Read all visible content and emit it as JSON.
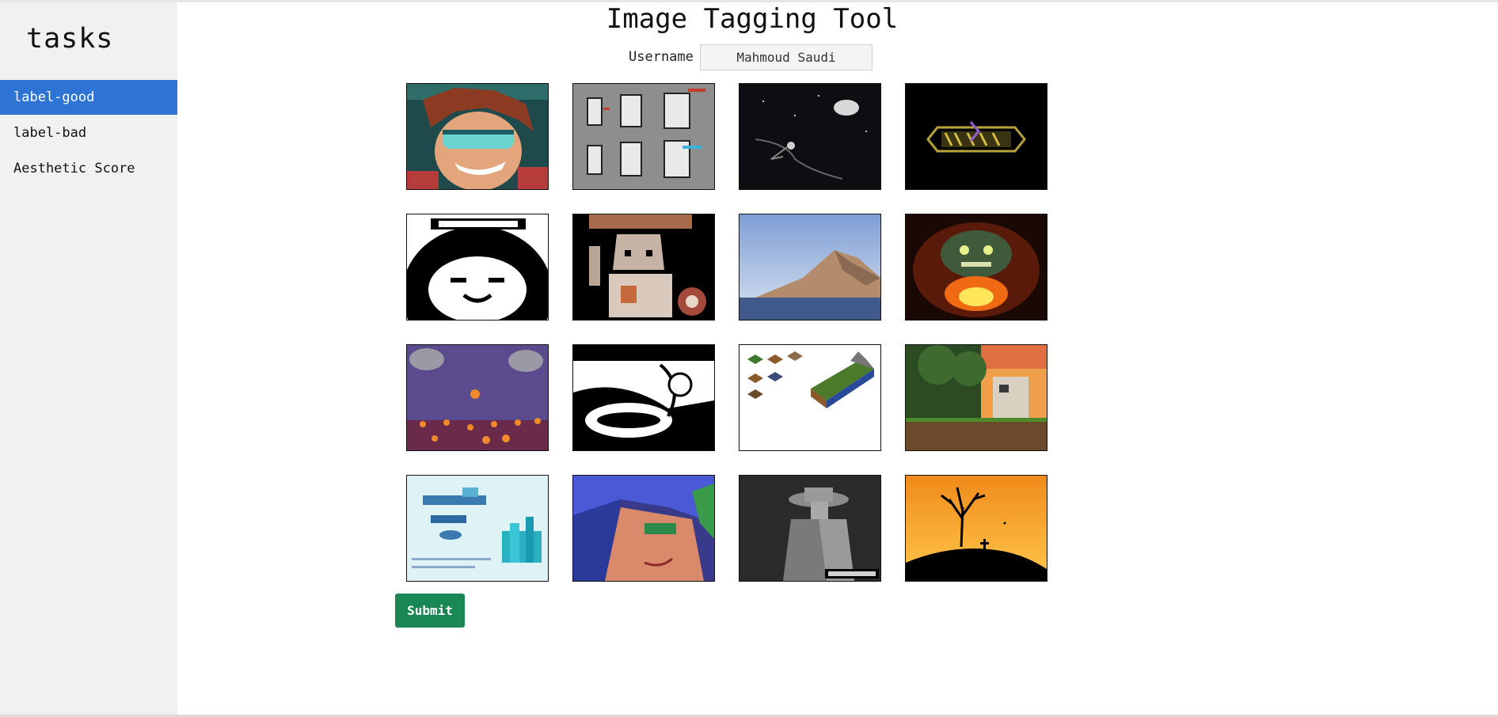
{
  "sidebar": {
    "title": "tasks",
    "items": [
      {
        "label": "label-good",
        "active": true
      },
      {
        "label": "label-bad",
        "active": false
      },
      {
        "label": "Aesthetic Score",
        "active": false
      }
    ]
  },
  "main": {
    "title": "Image Tagging Tool",
    "username_label": "Username",
    "username_value": "Mahmoud Saudi"
  },
  "images": [
    {
      "subject": "pixel-portrait-goggles"
    },
    {
      "subject": "pixel-robot-sprites"
    },
    {
      "subject": "night-sky-moon"
    },
    {
      "subject": "godzilla-logo"
    },
    {
      "subject": "sloth-face-bw"
    },
    {
      "subject": "robot-character"
    },
    {
      "subject": "mountain-landscape"
    },
    {
      "subject": "campfire-monster"
    },
    {
      "subject": "lantern-night-scene"
    },
    {
      "subject": "bw-sketch"
    },
    {
      "subject": "isometric-tiles"
    },
    {
      "subject": "platformer-game-level"
    },
    {
      "subject": "floating-city"
    },
    {
      "subject": "blue-hair-portrait"
    },
    {
      "subject": "noir-detective"
    },
    {
      "subject": "sunset-dead-tree"
    }
  ],
  "submit_label": "Submit",
  "colors": {
    "active": "#2e74d4",
    "submit": "#198754",
    "sidebar_bg": "#f1f1f1"
  }
}
